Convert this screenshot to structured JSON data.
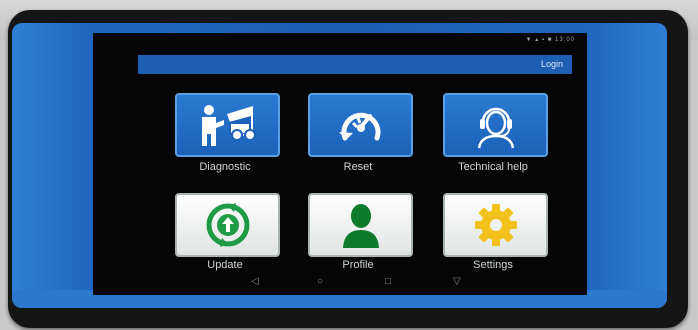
{
  "statusbar": {
    "text": "▼ ▴ ▪ ■ 13:00"
  },
  "appbar": {
    "login_label": "Login"
  },
  "tiles": [
    {
      "label": "Diagnostic",
      "icon": "car-diagnostic-icon"
    },
    {
      "label": "Reset",
      "icon": "gauge-reset-icon"
    },
    {
      "label": "Technical help",
      "icon": "headset-person-icon"
    },
    {
      "label": "Update",
      "icon": "refresh-arrows-icon"
    },
    {
      "label": "Profile",
      "icon": "person-icon"
    },
    {
      "label": "Settings",
      "icon": "gear-icon"
    }
  ],
  "navbar": {
    "back": "◁",
    "home": "○",
    "recents": "□",
    "down": "▽"
  },
  "colors": {
    "bumper_blue": "#1a5fb6",
    "appbar_blue": "#1f5fb3",
    "tile_blue": "#1b62b8",
    "update_green": "#1f9a45",
    "profile_green": "#0d7a2c",
    "settings_yellow": "#f2c21b"
  }
}
